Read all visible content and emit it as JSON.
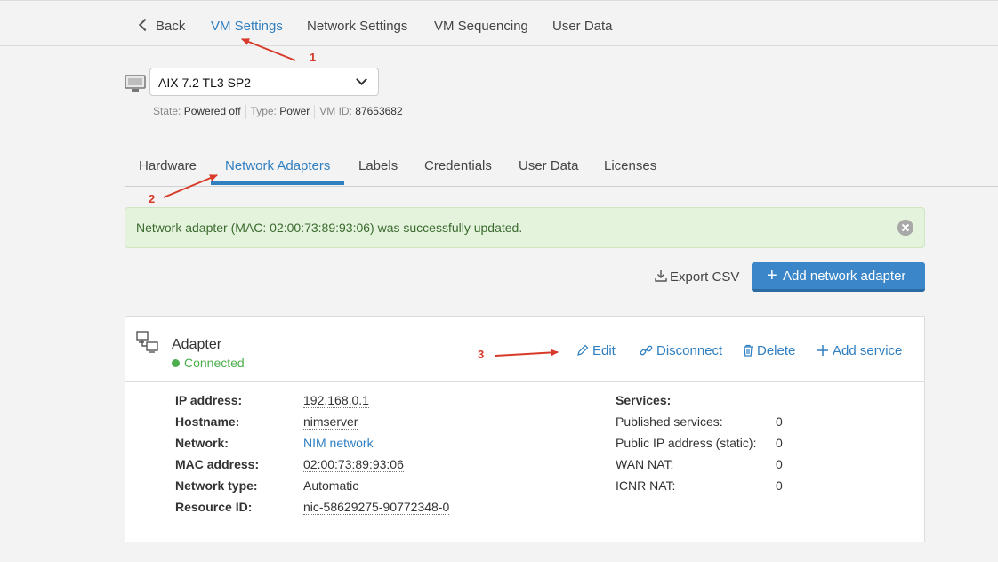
{
  "topnav": {
    "back_label": "Back",
    "tabs": [
      {
        "label": "VM Settings"
      },
      {
        "label": "Network Settings"
      },
      {
        "label": "VM Sequencing"
      },
      {
        "label": "User Data"
      }
    ]
  },
  "vm": {
    "selected": "AIX 7.2 TL3 SP2",
    "state_label": "State:",
    "state_value": "Powered off",
    "type_label": "Type:",
    "type_value": "Power",
    "id_label": "VM ID:",
    "id_value": "87653682"
  },
  "subtabs": [
    {
      "label": "Hardware"
    },
    {
      "label": "Network Adapters"
    },
    {
      "label": "Labels"
    },
    {
      "label": "Credentials"
    },
    {
      "label": "User Data"
    },
    {
      "label": "Licenses"
    }
  ],
  "alert": {
    "message": "Network adapter (MAC: 02:00:73:89:93:06) was successfully updated."
  },
  "toolbar": {
    "export_label": "Export CSV",
    "add_label": "Add network adapter"
  },
  "adapter": {
    "title": "Adapter",
    "status": "Connected",
    "actions": {
      "edit": "Edit",
      "disconnect": "Disconnect",
      "delete": "Delete",
      "add_service": "Add service"
    },
    "fields": [
      {
        "label": "IP address:",
        "value": "192.168.0.1"
      },
      {
        "label": "Hostname:",
        "value": "nimserver"
      },
      {
        "label": "Network:",
        "value": "NIM network"
      },
      {
        "label": "MAC address:",
        "value": "02:00:73:89:93:06"
      },
      {
        "label": "Network type:",
        "value": "Automatic"
      },
      {
        "label": "Resource ID:",
        "value": "nic-58629275-90772348-0"
      }
    ],
    "services_heading": "Services:",
    "services": [
      {
        "label": "Published services:",
        "value": "0"
      },
      {
        "label": "Public IP address (static):",
        "value": "0"
      },
      {
        "label": "WAN NAT:",
        "value": "0"
      },
      {
        "label": "ICNR NAT:",
        "value": "0"
      }
    ]
  },
  "annotations": [
    "1",
    "2",
    "3"
  ],
  "colors": {
    "accent": "#2f7fc1",
    "success": "#4cae4c",
    "annotation": "#d83a2a"
  }
}
